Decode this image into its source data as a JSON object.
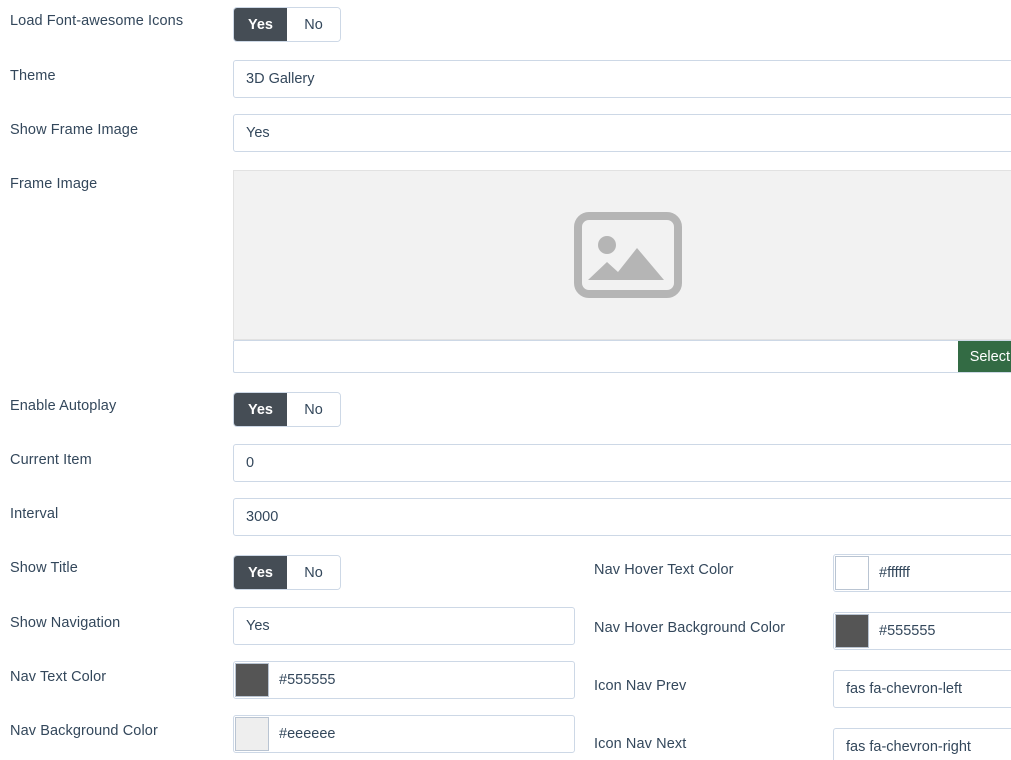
{
  "form": {
    "rows": [
      {
        "key": "load_fontawesome",
        "label": "Load Font-awesome Icons",
        "type": "toggle",
        "on_label": "Yes",
        "off_label": "No",
        "value": "Yes"
      },
      {
        "key": "theme",
        "label": "Theme",
        "type": "text",
        "value": "3D Gallery"
      },
      {
        "key": "show_frame_image",
        "label": "Show Frame Image",
        "type": "text",
        "value": "Yes"
      },
      {
        "key": "frame_image",
        "label": "Frame Image",
        "type": "media",
        "value": "",
        "placeholder_icon": "image-placeholder-icon",
        "select_label": "Select",
        "select_color": "#336b44"
      },
      {
        "key": "enable_autoplay",
        "label": "Enable Autoplay",
        "type": "toggle",
        "on_label": "Yes",
        "off_label": "No",
        "value": "Yes"
      },
      {
        "key": "current_item",
        "label": "Current Item",
        "type": "text",
        "value": "0"
      },
      {
        "key": "interval",
        "label": "Interval",
        "type": "text",
        "value": "3000"
      }
    ],
    "left_column": [
      {
        "key": "show_title",
        "label": "Show Title",
        "type": "toggle",
        "on_label": "Yes",
        "off_label": "No",
        "value": "Yes"
      },
      {
        "key": "show_navigation",
        "label": "Show Navigation",
        "type": "text",
        "value": "Yes"
      },
      {
        "key": "nav_text_color",
        "label": "Nav Text Color",
        "type": "color",
        "value": "#555555"
      },
      {
        "key": "nav_background_color",
        "label": "Nav Background Color",
        "type": "color",
        "value": "#eeeeee"
      }
    ],
    "right_column": [
      {
        "key": "nav_hover_text_color",
        "label": "Nav Hover Text Color",
        "type": "color",
        "value": "#ffffff"
      },
      {
        "key": "nav_hover_background_color",
        "label": "Nav Hover Background Color",
        "type": "color",
        "value": "#555555"
      },
      {
        "key": "icon_nav_prev",
        "label": "Icon Nav Prev",
        "type": "text",
        "value": "fas fa-chevron-left"
      },
      {
        "key": "icon_nav_next",
        "label": "Icon Nav Next",
        "type": "text",
        "value": "fas fa-chevron-right"
      }
    ]
  },
  "theme_colors": {
    "label_text": "#33475b",
    "input_border": "#cdd8e6",
    "toggle_active_bg": "#454d55",
    "preview_bg": "#f2f2f2",
    "select_button_bg": "#336b44"
  }
}
